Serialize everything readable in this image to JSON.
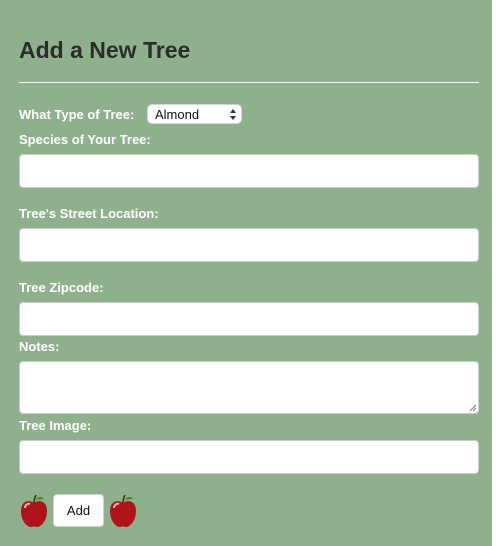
{
  "form": {
    "title": "Add a New Tree",
    "tree_type": {
      "label": "What Type of Tree:",
      "selected": "Almond"
    },
    "species": {
      "label": "Species of Your Tree:",
      "value": ""
    },
    "street": {
      "label": "Tree's Street Location:",
      "value": ""
    },
    "zipcode": {
      "label": "Tree Zipcode:",
      "value": ""
    },
    "notes": {
      "label": "Notes:",
      "value": ""
    },
    "image": {
      "label": "Tree Image:",
      "value": ""
    },
    "submit_label": "Add"
  },
  "colors": {
    "panel_background": "#8fb08c",
    "title_text": "#2a2e2a",
    "label_text": "#ffffff",
    "apple_red": "#b0141b"
  },
  "icons": {
    "apple_left": "red-apple-icon",
    "apple_right": "red-apple-icon"
  }
}
